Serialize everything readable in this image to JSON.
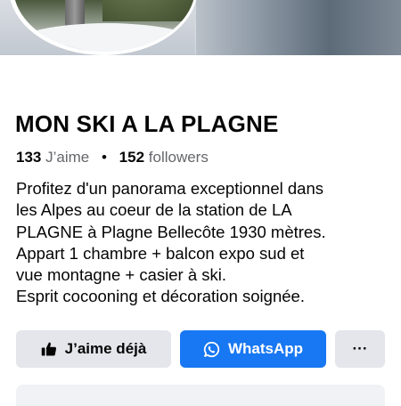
{
  "page": {
    "title": "MON SKI A LA PLAGNE",
    "stats": {
      "likes_count": "133",
      "likes_label": "J’aime",
      "separator": "•",
      "followers_count": "152",
      "followers_label": "followers"
    },
    "bio_lines": [
      "Profitez d'un panorama exceptionnel dans",
      "les Alpes au coeur de la station de LA",
      "PLAGNE à Plagne Bellecôte 1930 mètres.",
      "Appart 1 chambre + balcon expo sud et",
      "vue montagne + casier à ski.",
      "Esprit cocooning et décoration soignée."
    ]
  },
  "actions": {
    "like_label": "J’aime déjà",
    "like_icon": "thumbs-up-icon",
    "whatsapp_label": "WhatsApp",
    "whatsapp_icon": "whatsapp-icon",
    "more_label": "···"
  },
  "colors": {
    "accent": "#1877f2",
    "secondary_button": "#e4e6eb",
    "text": "#050505",
    "muted_text": "#65676b"
  }
}
